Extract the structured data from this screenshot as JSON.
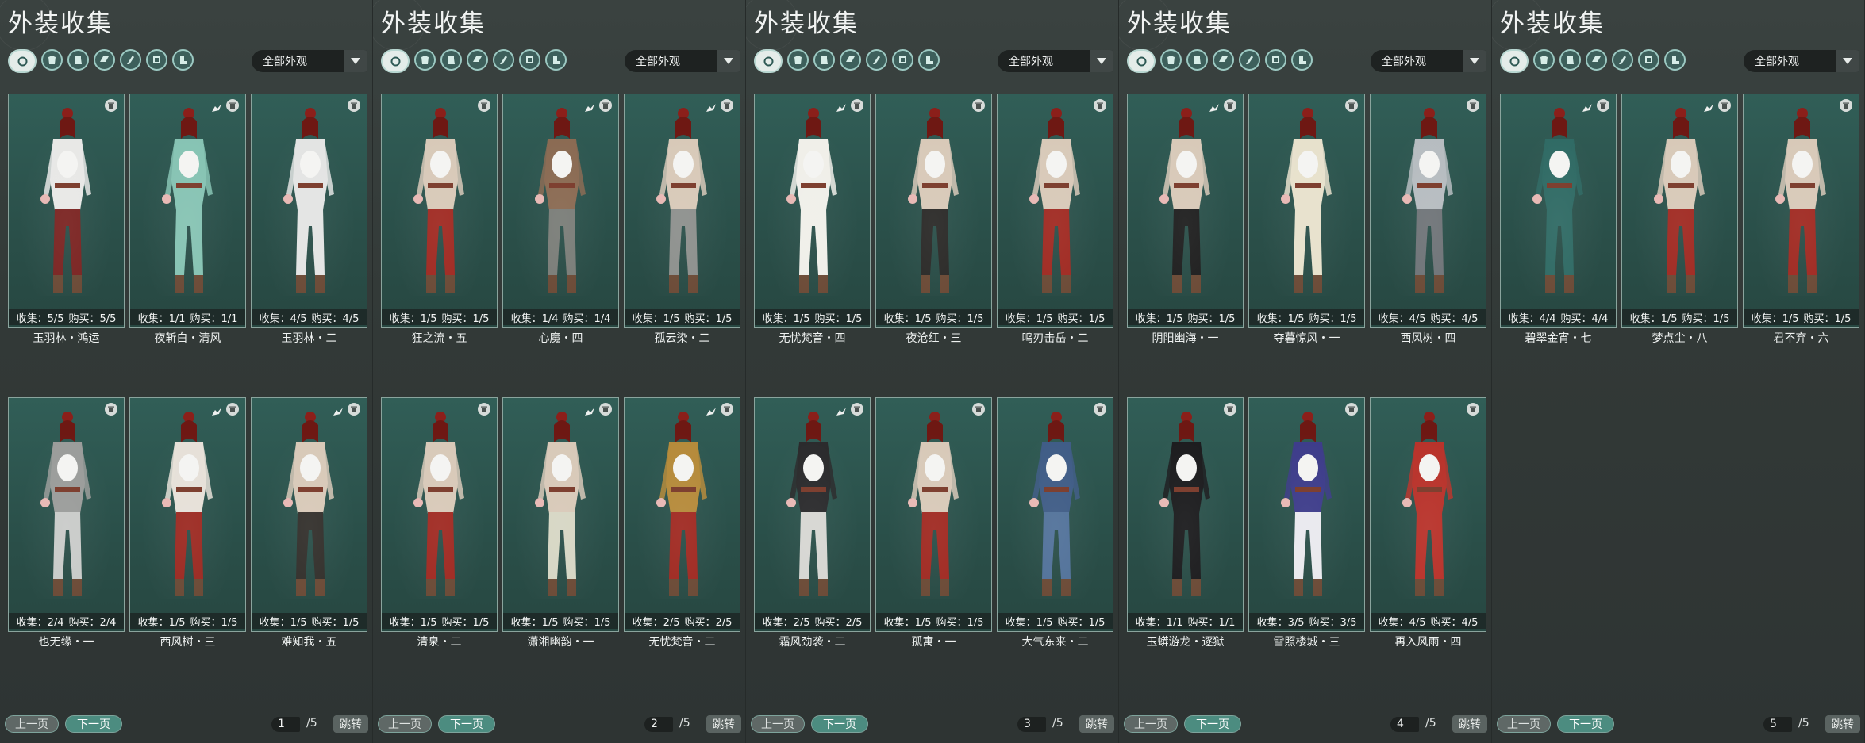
{
  "title": "外装收集",
  "filter_dropdown": "全部外观",
  "filter_icons": [
    "outfit-all-icon",
    "outfit-top-icon",
    "outfit-set-icon",
    "outfit-armor-icon",
    "outfit-cape-icon",
    "outfit-gloves-icon",
    "outfit-boots-icon"
  ],
  "labels": {
    "collect": "收集：",
    "buy": "购买："
  },
  "pager": {
    "prev": "上一页",
    "next": "下一页",
    "total": "/5",
    "jump": "跳转"
  },
  "colors": {
    "frame_bg": "#2a4f49",
    "accent": "#4c8c80",
    "panel_bg": "#323937"
  },
  "panels": [
    {
      "page": "1",
      "items": [
        {
          "name": "玉羽林・鸿运",
          "collect": "5/5",
          "buy": "5/5",
          "fav": false,
          "outfit": "#e8e8e6",
          "legs": "#7b2422"
        },
        {
          "name": "夜斩白・清风",
          "collect": "1/1",
          "buy": "1/1",
          "fav": true,
          "outfit": "#86c3b3",
          "legs": "#86c3b3"
        },
        {
          "name": "玉羽林・二",
          "collect": "4/5",
          "buy": "4/5",
          "fav": false,
          "outfit": "#e3e4e3",
          "legs": "#e3e4e3"
        },
        {
          "name": "也无缘・一",
          "collect": "2/4",
          "buy": "2/4",
          "fav": false,
          "outfit": "#9a9c9a",
          "legs": "#c9cbc9"
        },
        {
          "name": "西风树・三",
          "collect": "1/5",
          "buy": "1/5",
          "fav": true,
          "outfit": "#e6e0d8",
          "legs": "#9c2a22"
        },
        {
          "name": "难知我・五",
          "collect": "1/5",
          "buy": "1/5",
          "fav": true,
          "outfit": "#d8c9b8",
          "legs": "#33302c"
        }
      ]
    },
    {
      "page": "2",
      "items": [
        {
          "name": "狂之流・五",
          "collect": "1/5",
          "buy": "1/5",
          "fav": false,
          "outfit": "#d8c9b8",
          "legs": "#a02a22"
        },
        {
          "name": "心魔・四",
          "collect": "1/4",
          "buy": "1/4",
          "fav": true,
          "outfit": "#8a6a52",
          "legs": "#7a7d78"
        },
        {
          "name": "孤云染・二",
          "collect": "1/5",
          "buy": "1/5",
          "fav": true,
          "outfit": "#d8c9b8",
          "legs": "#8d908d"
        },
        {
          "name": "清泉・二",
          "collect": "1/5",
          "buy": "1/5",
          "fav": false,
          "outfit": "#d8c9b8",
          "legs": "#a02a22"
        },
        {
          "name": "潇湘幽韵・一",
          "collect": "1/5",
          "buy": "1/5",
          "fav": true,
          "outfit": "#d8c9b8",
          "legs": "#d6d6c4"
        },
        {
          "name": "无忧梵音・二",
          "collect": "2/5",
          "buy": "2/5",
          "fav": true,
          "outfit": "#b58a3a",
          "legs": "#a02a22"
        }
      ]
    },
    {
      "page": "3",
      "items": [
        {
          "name": "无忧梵音・四",
          "collect": "1/5",
          "buy": "1/5",
          "fav": true,
          "outfit": "#f0efe9",
          "legs": "#f0efe9"
        },
        {
          "name": "夜沧红・三",
          "collect": "1/5",
          "buy": "1/5",
          "fav": false,
          "outfit": "#d8c9b8",
          "legs": "#2b2a28"
        },
        {
          "name": "鸣刃击岳・二",
          "collect": "1/5",
          "buy": "1/5",
          "fav": false,
          "outfit": "#d8c9b8",
          "legs": "#a02a22"
        },
        {
          "name": "霜风劲袭・二",
          "collect": "2/5",
          "buy": "2/5",
          "fav": true,
          "outfit": "#2a2a2c",
          "legs": "#d6d6d2"
        },
        {
          "name": "孤寓・一",
          "collect": "1/5",
          "buy": "1/5",
          "fav": false,
          "outfit": "#d8c9b8",
          "legs": "#a02a22"
        },
        {
          "name": "大气东来・二",
          "collect": "1/5",
          "buy": "1/5",
          "fav": false,
          "outfit": "#3f5c86",
          "legs": "#52729a"
        }
      ]
    },
    {
      "page": "4",
      "items": [
        {
          "name": "阴阳幽海・一",
          "collect": "1/5",
          "buy": "1/5",
          "fav": true,
          "outfit": "#d8c9b8",
          "legs": "#1f1f1f"
        },
        {
          "name": "夺暮惊风・一",
          "collect": "1/5",
          "buy": "1/5",
          "fav": false,
          "outfit": "#e7e1cc",
          "legs": "#e7e1cc"
        },
        {
          "name": "西风树・四",
          "collect": "4/5",
          "buy": "4/5",
          "fav": false,
          "outfit": "#b6bcc0",
          "legs": "#6f7478"
        },
        {
          "name": "玉蟒游龙・逐狱",
          "collect": "1/1",
          "buy": "1/1",
          "fav": false,
          "outfit": "#1c1c1e",
          "legs": "#1c1c1e"
        },
        {
          "name": "雪照楼城・三",
          "collect": "3/5",
          "buy": "3/5",
          "fav": false,
          "outfit": "#3d3c8a",
          "legs": "#e9e9ee"
        },
        {
          "name": "再入风雨・四",
          "collect": "4/5",
          "buy": "4/5",
          "fav": false,
          "outfit": "#b8322a",
          "legs": "#b8322a"
        }
      ]
    },
    {
      "page": "5",
      "items": [
        {
          "name": "碧翠金宵・七",
          "collect": "4/4",
          "buy": "4/4",
          "fav": true,
          "outfit": "#2f6a64",
          "legs": "#2f6a64"
        },
        {
          "name": "梦点尘・八",
          "collect": "1/5",
          "buy": "1/5",
          "fav": true,
          "outfit": "#d8c9b8",
          "legs": "#a02a22"
        },
        {
          "name": "君不弃・六",
          "collect": "1/5",
          "buy": "1/5",
          "fav": false,
          "outfit": "#d8c9b8",
          "legs": "#a02a22"
        }
      ]
    }
  ]
}
